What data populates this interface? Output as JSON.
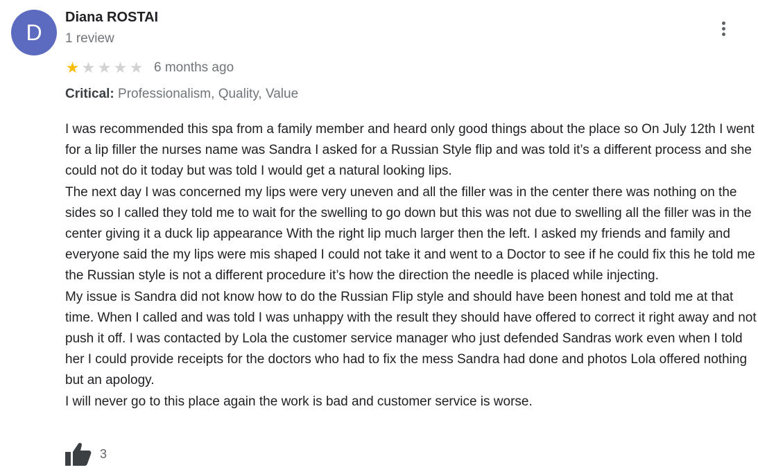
{
  "reviewer": {
    "initial": "D",
    "name": "Diana ROSTAI",
    "review_count": "1 review",
    "avatar_color": "#5c6bc0"
  },
  "rating": {
    "stars": 1,
    "max_stars": 5,
    "filled_color": "#fbbc04",
    "empty_color": "#d2d2d2",
    "time": "6 months ago"
  },
  "critical": {
    "label": "Critical:",
    "values": "Professionalism, Quality, Value"
  },
  "review_paragraphs": [
    "I was recommended this spa from a family member and heard only good things about the place so On July 12th I went for a lip filler the nurses name was Sandra I asked for a Russian Style flip and was told it’s a different process and she could not do it today but was told I would get a natural looking lips.",
    "The next day I was concerned my lips were very uneven and all the filler was in the center there was nothing on the sides so I called they told me to wait for the swelling to go down but this was not due to swelling all the filler was in the center giving it a duck lip appearance With the right lip much larger then the left. I asked my friends and family and everyone said the my lips were mis shaped I could not take it and went to a Doctor to see if he could fix this he told me the Russian style is not a different procedure it’s how the direction the needle is placed while injecting.",
    "My issue is Sandra did not know how to do the Russian Flip style and should have been honest and told me at that time. When I called and was told I was unhappy with the result they should have offered to correct it right away and not push it off. I was contacted by Lola the customer service manager who just defended Sandras work even when I told her I could provide receipts for the doctors who had to fix the mess Sandra had done and photos Lola offered nothing but an apology.",
    "I will never go to this place again the work is bad and customer service is worse."
  ],
  "likes": {
    "icon": "thumbs-up-icon",
    "count": "3"
  },
  "menu": {
    "icon": "more-vert-icon"
  }
}
